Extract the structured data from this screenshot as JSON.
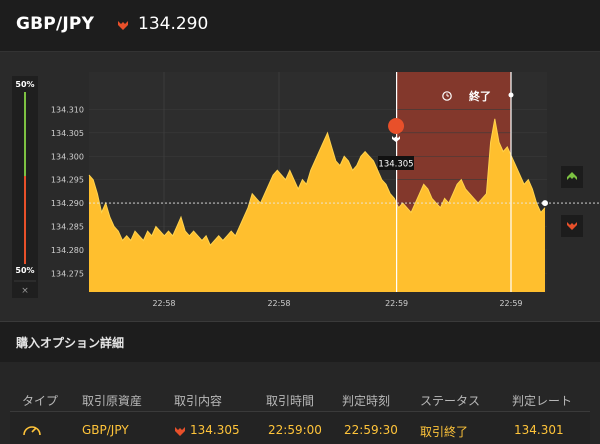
{
  "header": {
    "pair": "GBP/JPY",
    "direction": "down",
    "price": "134.290"
  },
  "chart": {
    "type": "area",
    "y_ticks": [
      "134.310",
      "134.305",
      "134.300",
      "134.295",
      "134.290",
      "134.285",
      "134.280",
      "134.275"
    ],
    "x_ticks": [
      "22:58",
      "22:58",
      "22:59",
      "22:59"
    ],
    "gauge_top": "50%",
    "gauge_bottom": "50%",
    "gauge_close": "×",
    "end_label": "終了",
    "entry_label": "134.305",
    "current_level": "134.290",
    "colors": {
      "area": "#ffbf2e",
      "zone": "#8b3a2c",
      "up": "#7dc242",
      "down": "#e8502a",
      "bg": "#2a2a2a"
    }
  },
  "chart_data": {
    "type": "area",
    "ylim": [
      134.271,
      134.318
    ],
    "series": [
      {
        "values": [
          134.296,
          134.295,
          134.292,
          134.288,
          134.29,
          134.287,
          134.285,
          134.284,
          134.282,
          134.283,
          134.282,
          134.284,
          134.283,
          134.282,
          134.284,
          134.283,
          134.285,
          134.284,
          134.283,
          134.284,
          134.283,
          134.285,
          134.287,
          134.284,
          134.283,
          134.284,
          134.283,
          134.282,
          134.283,
          134.281,
          134.282,
          134.283,
          134.282,
          134.283,
          134.284,
          134.283,
          134.285,
          134.287,
          134.289,
          134.292,
          134.291,
          134.29,
          134.292,
          134.294,
          134.296,
          134.297,
          134.296,
          134.295,
          134.297,
          134.295,
          134.293,
          134.295,
          134.294,
          134.297,
          134.299,
          134.301,
          134.303,
          134.305,
          134.302,
          134.299,
          134.298,
          134.3,
          134.299,
          134.297,
          134.298,
          134.3,
          134.301,
          134.3,
          134.299,
          134.297,
          134.295,
          134.294,
          134.292,
          134.291,
          134.289,
          134.29,
          134.289,
          134.288,
          134.29,
          134.292,
          134.294,
          134.293,
          134.291,
          134.29,
          134.289,
          134.291,
          134.29,
          134.292,
          134.294,
          134.295,
          134.293,
          134.292,
          134.291,
          134.29,
          134.291,
          134.292,
          134.303,
          134.308,
          134.303,
          134.301,
          134.302,
          134.3,
          134.298,
          134.296,
          134.294,
          134.295,
          134.293,
          134.29,
          134.288,
          134.289
        ]
      }
    ]
  },
  "table": {
    "section_title": "購入オプション詳細",
    "headers": [
      "タイプ",
      "取引原資産",
      "取引内容",
      "取引時間",
      "判定時刻",
      "ステータス",
      "判定レート"
    ],
    "row": {
      "asset": "GBP/JPY",
      "direction": "down",
      "trade_rate": "134.305",
      "trade_time": "22:59:00",
      "judge_time": "22:59:30",
      "status": "取引終了",
      "judge_rate": "134.301"
    }
  }
}
